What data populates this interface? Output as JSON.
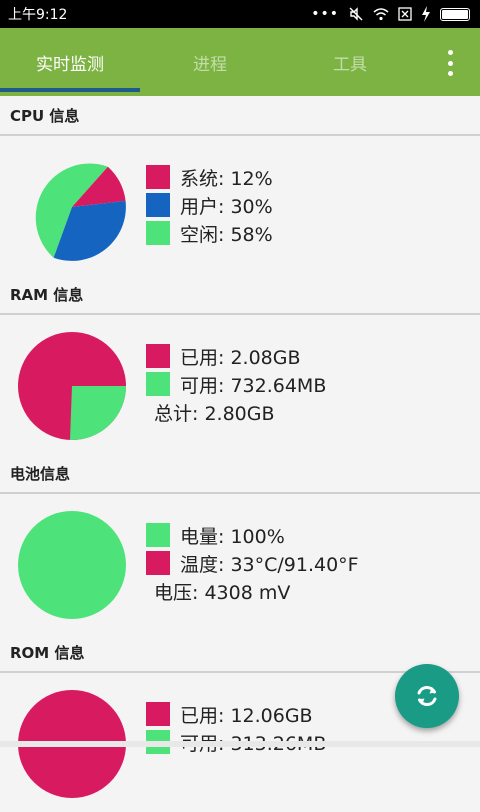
{
  "status_bar": {
    "time": "上午9:12",
    "icons": [
      "more-dots",
      "mute",
      "wifi",
      "sim-x",
      "charging",
      "battery"
    ]
  },
  "tabs": [
    {
      "label": "实时监测",
      "active": true
    },
    {
      "label": "进程",
      "active": false
    },
    {
      "label": "工具",
      "active": false
    }
  ],
  "sections": {
    "cpu": {
      "title": "CPU 信息",
      "legend": [
        {
          "label": "系统: 12%",
          "color": "#d81b60",
          "value": 12
        },
        {
          "label": "用户: 30%",
          "color": "#1565c0",
          "value": 30
        },
        {
          "label": "空闲: 58%",
          "color": "#4ee37a",
          "value": 58
        }
      ]
    },
    "ram": {
      "title": "RAM 信息",
      "legend": [
        {
          "label": "已用: 2.08GB",
          "color": "#d81b60",
          "value": 74.3
        },
        {
          "label": "可用: 732.64MB",
          "color": "#4ee37a",
          "value": 25.7
        }
      ],
      "total": "总计: 2.80GB"
    },
    "battery": {
      "title": "电池信息",
      "legend": [
        {
          "label": "电量: 100%",
          "color": "#4ee37a",
          "value": 100
        },
        {
          "label": "温度: 33°C/91.40°F",
          "color": "#d81b60"
        }
      ],
      "voltage": "电压: 4308 mV"
    },
    "rom": {
      "title": "ROM 信息",
      "legend": [
        {
          "label": "已用: 12.06GB",
          "color": "#d81b60"
        },
        {
          "label": "可用: 313.26MB",
          "color": "#4ee37a"
        }
      ]
    }
  },
  "fab": {
    "icon": "refresh-icon",
    "color": "#1a9b86"
  }
}
